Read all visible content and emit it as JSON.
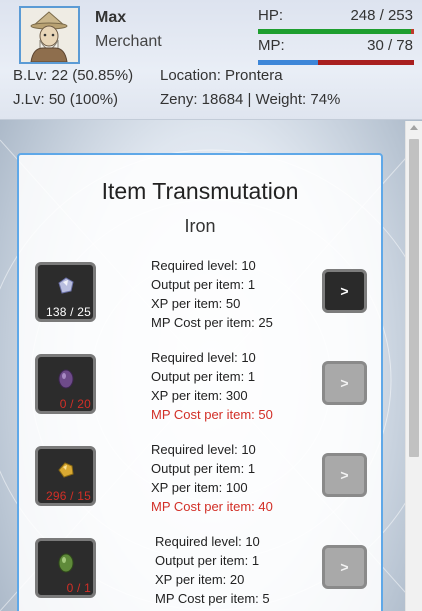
{
  "character": {
    "name": "Max",
    "class": "Merchant",
    "hp_label": "HP:",
    "hp_value": "248 / 253",
    "hp_fraction": 0.98,
    "mp_label": "MP:",
    "mp_value": "30 / 78",
    "mp_fraction": 0.385,
    "base_level": "B.Lv: 22 (50.85%)",
    "job_level": "J.Lv: 50 (100%)",
    "location": "Location: Prontera",
    "zeny_weight": "Zeny: 18684 | Weight: 74%"
  },
  "panel": {
    "title": "Item Transmutation",
    "subtitle": "Iron",
    "recipes": [
      {
        "icon": "iron-ore-icon",
        "count": "138 / 25",
        "count_ok": true,
        "required_level": "Required level: 10",
        "output": "Output per item: 1",
        "xp": "XP per item: 50",
        "mp_cost": "MP Cost per item: 25",
        "mp_ok": true,
        "button": ">",
        "enabled": true
      },
      {
        "icon": "purple-stone-icon",
        "count": "0 / 20",
        "count_ok": false,
        "required_level": "Required level: 10",
        "output": "Output per item: 1",
        "xp": "XP per item: 300",
        "mp_cost": "MP Cost per item: 50",
        "mp_ok": false,
        "button": ">",
        "enabled": false
      },
      {
        "icon": "gold-ore-icon",
        "count": "296 / 15",
        "count_ok": false,
        "required_level": "Required level: 10",
        "output": "Output per item: 1",
        "xp": "XP per item: 100",
        "mp_cost": "MP Cost per item: 40",
        "mp_ok": false,
        "button": ">",
        "enabled": false
      },
      {
        "icon": "green-stone-icon",
        "count": "0 / 1",
        "count_ok": false,
        "required_level": "Required level: 10",
        "output": "Output per item: 1",
        "xp": "XP per item: 20",
        "mp_cost": "MP Cost per item: 5",
        "mp_ok": true,
        "button": ">",
        "enabled": false
      }
    ]
  },
  "colors": {
    "hp_fill": "#1e9e2f",
    "hp_empty": "#c0392b",
    "mp_fill": "#3d86d8",
    "mp_empty": "#a81f1f",
    "panel_border": "#5fa8e8",
    "warning_text": "#d22f27"
  }
}
